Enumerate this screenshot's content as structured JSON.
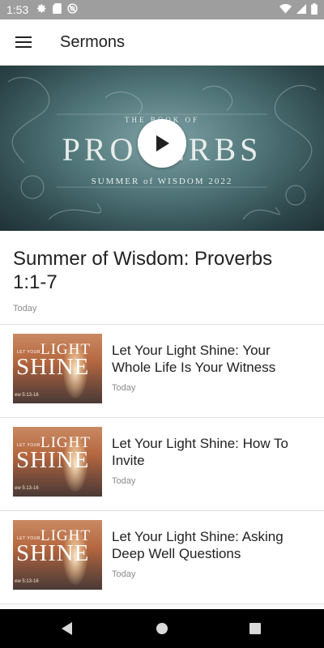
{
  "status_bar": {
    "time": "1:53",
    "icons_left": [
      "settings-icon",
      "sd-card-icon",
      "sync-icon"
    ],
    "icons_right": [
      "wifi-icon",
      "signal-icon",
      "battery-icon"
    ]
  },
  "app_bar": {
    "title": "Sermons",
    "menu_icon": "hamburger-menu-icon"
  },
  "hero": {
    "kicker": "THE BOOK OF",
    "title": "PROVERBS",
    "subtitle": "SUMMER of WISDOM 2022",
    "play_icon": "play-icon"
  },
  "featured": {
    "title": "Summer of Wisdom: Proverbs 1:1-7",
    "date": "Today"
  },
  "thumbnail": {
    "small": "LET YOUR",
    "light": "LIGHT",
    "shine": "SHINE",
    "verse": "ew 5:13-16"
  },
  "sermons": [
    {
      "title": "Let Your Light Shine: Your Whole Life Is Your Witness",
      "date": "Today"
    },
    {
      "title": "Let Your Light Shine: How To Invite",
      "date": "Today"
    },
    {
      "title": "Let Your Light Shine: Asking Deep Well Questions",
      "date": "Today"
    }
  ],
  "nav_bar": {
    "back_icon": "back-triangle-icon",
    "home_icon": "home-circle-icon",
    "recent_icon": "recent-apps-square-icon"
  },
  "colors": {
    "status_bar": "#9e9e9e",
    "app_bar": "#ffffff",
    "background": "#fafafa",
    "divider": "#e0e0e0",
    "nav_bar": "#000000"
  }
}
